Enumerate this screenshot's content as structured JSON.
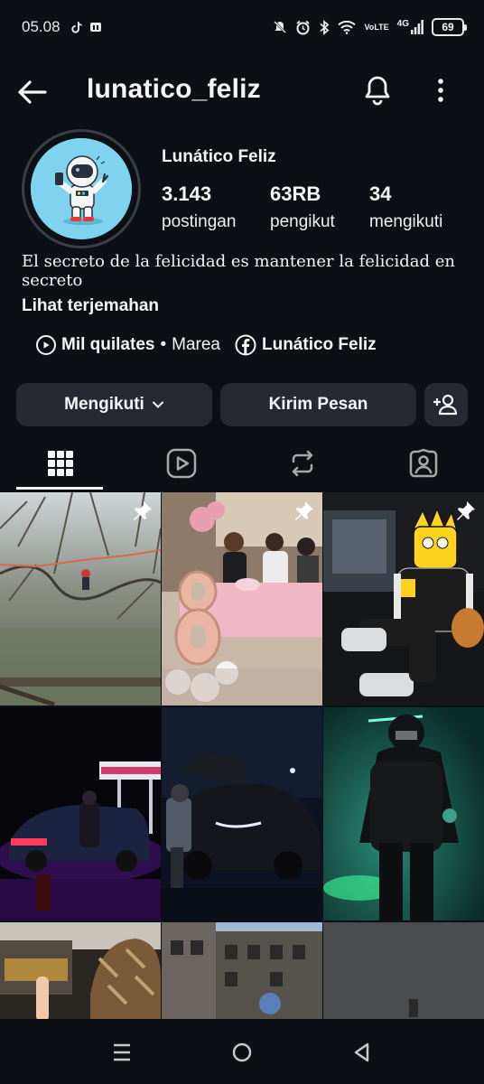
{
  "status_bar": {
    "time": "05.08",
    "network_label_top": "Vo",
    "network_label_bottom": "LTE",
    "signal_type": "4G",
    "battery": "69"
  },
  "header": {
    "username": "lunatico_feliz"
  },
  "profile": {
    "display_name": "Lunático Feliz",
    "stats": [
      {
        "value": "3.143",
        "label": "postingan"
      },
      {
        "value": "63RB",
        "label": "pengikut"
      },
      {
        "value": "34",
        "label": "mengikuti"
      }
    ],
    "bio": "El secreto de la felicidad es mantener la felicidad en secreto",
    "translate_link": "Lihat terjemahan",
    "music": {
      "title": "Mil quilates",
      "separator": "•",
      "artist": "Marea"
    },
    "facebook_link": "Lunático Feliz"
  },
  "actions": {
    "following_label": "Mengikuti",
    "message_label": "Kirim Pesan"
  },
  "tabs": [
    "grid-icon",
    "reels-icon",
    "reposts-icon",
    "tagged-icon"
  ]
}
